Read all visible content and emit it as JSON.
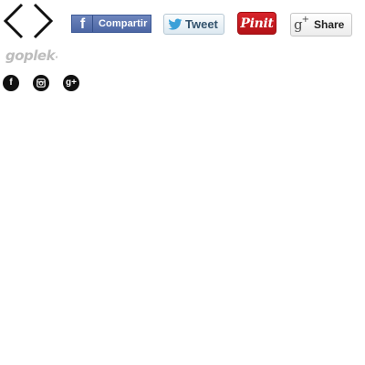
{
  "navigation": {
    "prev_icon": "chevron-left-icon",
    "next_icon": "chevron-right-icon"
  },
  "share_buttons": {
    "facebook": {
      "icon": "facebook-icon",
      "icon_glyph": "f",
      "label": "Compartir",
      "color": "#4c66a4"
    },
    "twitter": {
      "icon": "twitter-bird-icon",
      "label": "Tweet",
      "color": "#33536d"
    },
    "pinterest": {
      "label": "Pinit",
      "color": "#c8232c"
    },
    "googleplus": {
      "icon": "google-plus-icon",
      "icon_glyph": "g",
      "icon_sup": "+",
      "label": "Share"
    }
  },
  "brand": {
    "logo_text": "goplek",
    "logo_suffix": "·",
    "color": "#bdbdbd"
  },
  "social_links": [
    {
      "name": "facebook",
      "icon": "facebook-icon",
      "glyph": "f"
    },
    {
      "name": "instagram",
      "icon": "instagram-icon"
    },
    {
      "name": "google-plus",
      "icon": "google-plus-icon",
      "glyph": "g+"
    }
  ]
}
